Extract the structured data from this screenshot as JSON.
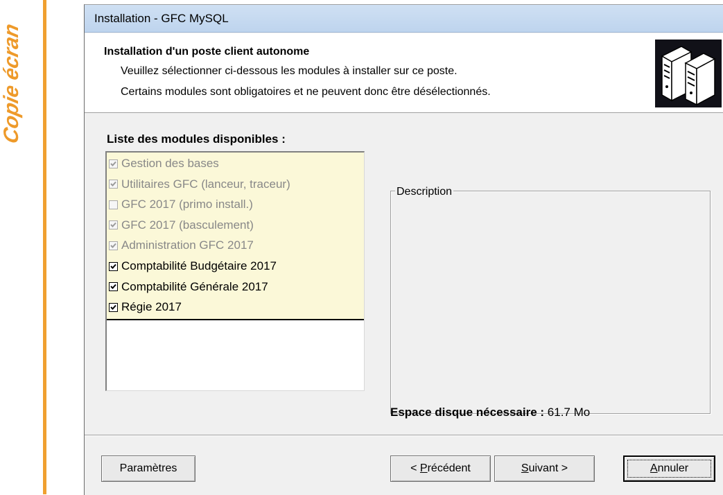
{
  "side_label": "Copie écran",
  "window": {
    "title": "Installation - GFC MySQL"
  },
  "header": {
    "title": "Installation d'un poste client autonome",
    "line1": "Veuillez sélectionner ci-dessous les modules à installer sur ce poste.",
    "line2": "Certains modules sont obligatoires et ne peuvent donc être désélectionnés.",
    "icon": "server-icon"
  },
  "modules": {
    "heading": "Liste des modules disponibles :",
    "items": [
      {
        "label": "Gestion des bases",
        "checked": true,
        "enabled": false
      },
      {
        "label": "Utilitaires GFC (lanceur, traceur)",
        "checked": true,
        "enabled": false
      },
      {
        "label": "GFC 2017 (primo install.)",
        "checked": false,
        "enabled": false
      },
      {
        "label": "GFC 2017 (basculement)",
        "checked": true,
        "enabled": false
      },
      {
        "label": "Administration GFC 2017",
        "checked": true,
        "enabled": false
      },
      {
        "label": "Comptabilité Budgétaire 2017",
        "checked": true,
        "enabled": true
      },
      {
        "label": "Comptabilité Générale 2017",
        "checked": true,
        "enabled": true
      },
      {
        "label": "Régie 2017",
        "checked": true,
        "enabled": true
      }
    ]
  },
  "description": {
    "legend": "Description"
  },
  "disk": {
    "label": "Espace disque nécessaire :",
    "value": "61.7 Mo"
  },
  "buttons": {
    "parameters": "Paramètres",
    "previous_prefix": "< ",
    "previous_key": "P",
    "previous_rest": "récédent",
    "next_key": "S",
    "next_rest": "uivant >",
    "cancel_key": "A",
    "cancel_rest": "nnuler"
  },
  "colors": {
    "accent_orange": "#f0a030",
    "list_bg": "#fbf8d8",
    "titlebar": "#c4d8f0"
  }
}
